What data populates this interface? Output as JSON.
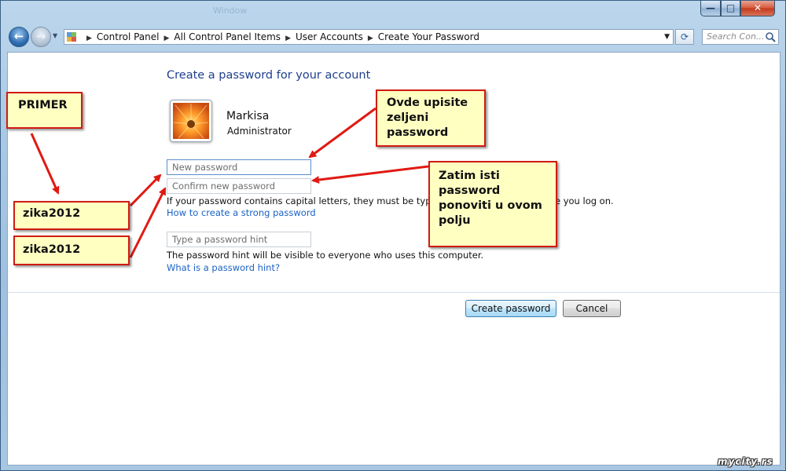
{
  "window": {
    "caption": "Window",
    "minimize_glyph": "—",
    "maximize_glyph": "□",
    "close_glyph": "✕"
  },
  "nav": {
    "back_icon": "arrow-left-icon",
    "forward_icon": "arrow-right-icon",
    "breadcrumbs": [
      "Control Panel",
      "All Control Panel Items",
      "User Accounts",
      "Create Your Password"
    ],
    "search_placeholder": "Search Con...",
    "refresh_icon": "refresh-icon"
  },
  "page": {
    "title": "Create a password for your account",
    "user": {
      "name": "Markisa",
      "role": "Administrator"
    },
    "new_password_placeholder": "New password",
    "confirm_password_placeholder": "Confirm new password",
    "caps_note": "If your password contains capital letters, they must be typed the same way every time you log on.",
    "strong_link": "How to create a strong password",
    "hint_placeholder": "Type a password hint",
    "hint_note": "The password hint will be visible to everyone who uses this computer.",
    "hint_link": "What is a password hint?",
    "create_button": "Create password",
    "cancel_button": "Cancel"
  },
  "annotations": {
    "primer": "PRIMER",
    "example_1": "zika2012",
    "example_2": "zika2012",
    "desc_1": "Ovde upisite zeljeni password",
    "desc_2": "Zatim isti password ponoviti u ovom polju"
  },
  "colors": {
    "link": "#1a62c6",
    "title": "#1e3f8f",
    "note_bg": "#ffffc2",
    "note_border": "#d11b12",
    "arrow": "#e01a12"
  },
  "watermark": "mycity.rs"
}
